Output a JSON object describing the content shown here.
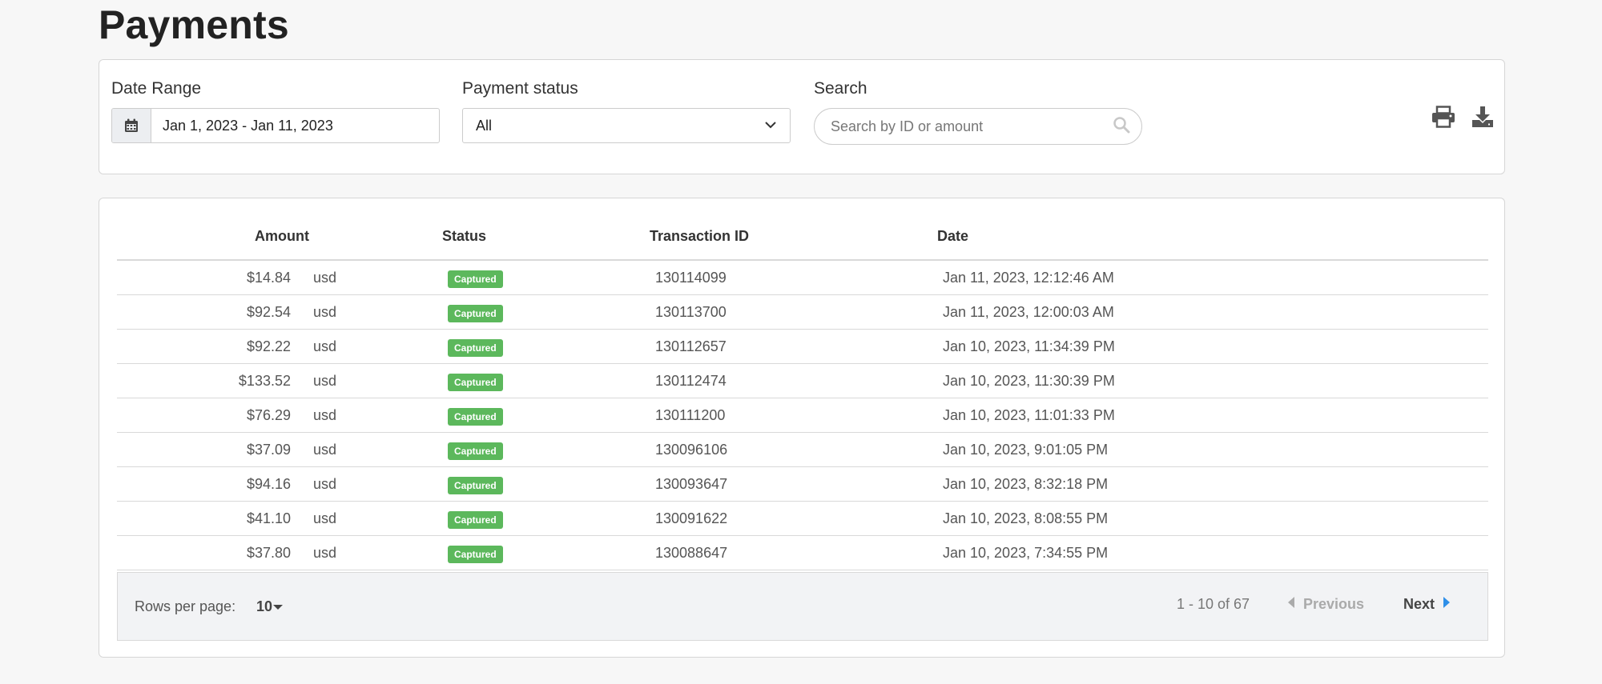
{
  "page": {
    "title": "Payments"
  },
  "filters": {
    "date_range": {
      "label": "Date Range",
      "value": "Jan 1, 2023 - Jan 11, 2023"
    },
    "payment_status": {
      "label": "Payment status",
      "value": "All"
    },
    "search": {
      "label": "Search",
      "placeholder": "Search by ID or amount",
      "value": ""
    }
  },
  "table": {
    "columns": {
      "amount": "Amount",
      "status": "Status",
      "transaction_id": "Transaction ID",
      "date": "Date"
    },
    "rows": [
      {
        "amount": "$14.84",
        "currency": "usd",
        "status": "Captured",
        "transaction_id": "130114099",
        "date": "Jan 11, 2023, 12:12:46 AM"
      },
      {
        "amount": "$92.54",
        "currency": "usd",
        "status": "Captured",
        "transaction_id": "130113700",
        "date": "Jan 11, 2023, 12:00:03 AM"
      },
      {
        "amount": "$92.22",
        "currency": "usd",
        "status": "Captured",
        "transaction_id": "130112657",
        "date": "Jan 10, 2023, 11:34:39 PM"
      },
      {
        "amount": "$133.52",
        "currency": "usd",
        "status": "Captured",
        "transaction_id": "130112474",
        "date": "Jan 10, 2023, 11:30:39 PM"
      },
      {
        "amount": "$76.29",
        "currency": "usd",
        "status": "Captured",
        "transaction_id": "130111200",
        "date": "Jan 10, 2023, 11:01:33 PM"
      },
      {
        "amount": "$37.09",
        "currency": "usd",
        "status": "Captured",
        "transaction_id": "130096106",
        "date": "Jan 10, 2023, 9:01:05 PM"
      },
      {
        "amount": "$94.16",
        "currency": "usd",
        "status": "Captured",
        "transaction_id": "130093647",
        "date": "Jan 10, 2023, 8:32:18 PM"
      },
      {
        "amount": "$41.10",
        "currency": "usd",
        "status": "Captured",
        "transaction_id": "130091622",
        "date": "Jan 10, 2023, 8:08:55 PM"
      },
      {
        "amount": "$37.80",
        "currency": "usd",
        "status": "Captured",
        "transaction_id": "130088647",
        "date": "Jan 10, 2023, 7:34:55 PM"
      }
    ],
    "status_color": "#5cb85c"
  },
  "pagination": {
    "rows_per_page_label": "Rows per page:",
    "rows_per_page_value": "10",
    "range_text": "1 - 10 of 67",
    "previous_label": "Previous",
    "next_label": "Next",
    "next_arrow_color": "#2f8fe8"
  },
  "icons": {
    "date": "calendar-icon",
    "status": "chevron-down-icon",
    "search": "search-icon",
    "print": "print-icon",
    "download": "download-icon"
  }
}
